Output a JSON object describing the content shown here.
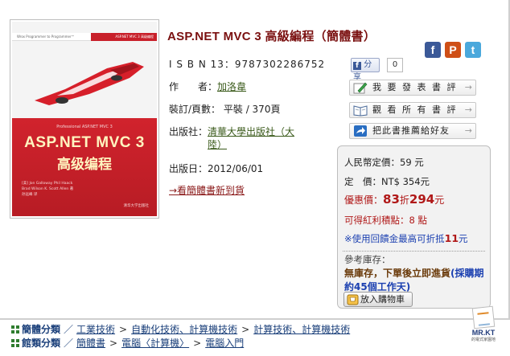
{
  "book": {
    "title": "ASP.NET MVC 3 高級編程（簡體書）",
    "isbn_label": "I S B N 13：",
    "isbn": "9787302286752",
    "author_label_a": "作",
    "author_label_b": "者：",
    "author": "加洛韋",
    "binding_label": "裝訂/頁數：",
    "binding": "平裝 / 370頁",
    "publisher_label": "出版社：",
    "publisher": "清華大學出版社（大陸）",
    "date_label": "出版日：",
    "date": "2012/06/01",
    "notify_link": "→看簡體書新到貨"
  },
  "cover": {
    "tagline": "Wrox Programmer to Programmer™",
    "badge": "ASP.NET MVC 3 高级编程",
    "series": "Professional ASP.NET MVC 3",
    "title_en": "ASP.NET MVC 3",
    "title_cn": "高级编程",
    "authors": [
      "[美] Jon Galloway  Phil Haack",
      "Brad Wilson  K. Scott Allen  著",
      "孙远峰  译"
    ],
    "publisher": "清华大学出版社"
  },
  "social": {
    "facebook": "f",
    "plurk": "P",
    "twitter": "t",
    "share_label": "分享",
    "share_count": "0"
  },
  "actions": [
    {
      "label": "我 要 發 表 書 評",
      "icon": "pencil-note-icon"
    },
    {
      "label": "觀 看 所 有 書 評",
      "icon": "open-book-icon"
    },
    {
      "label": "把此書推薦給好友",
      "icon": "share-arrow-icon"
    }
  ],
  "price": {
    "list_label": "人民幣定價：",
    "list_value": "59 元",
    "fixed_label": "定　價：",
    "fixed_value": "NT$ 354元",
    "sale_label": "優惠價：",
    "sale_discount": "83",
    "sale_discount_unit": "折",
    "sale_value": "294",
    "sale_unit": "元",
    "points_label": "可得紅利積點：",
    "points_value": "8 點",
    "gift_text": "※使用回饋金最高可折抵",
    "gift_value": "11",
    "gift_unit": "元",
    "stock_label": "參考庫存：",
    "stock_text": "無庫存，下單後立即進貨",
    "stock_note": "(採購期約45個工作天)",
    "cart_label": "放入購物車"
  },
  "watermark": {
    "title": "MR.KT",
    "sub": "的電式家園地"
  },
  "categories": {
    "simplified": {
      "label": "簡體分類",
      "path": [
        "工業技術",
        "自動化技術、計算機技術",
        "計算技術、計算機技術"
      ]
    },
    "store": {
      "label": "館類分類",
      "path": [
        "簡體書",
        "電腦〈計算機〉",
        "電腦入門"
      ]
    }
  },
  "colors": {
    "title": "#7a1010",
    "sale": "#b01818",
    "link_green": "#3a5a1a",
    "category_blue": "#1a3f7a",
    "cover_red": "#c8202a"
  }
}
